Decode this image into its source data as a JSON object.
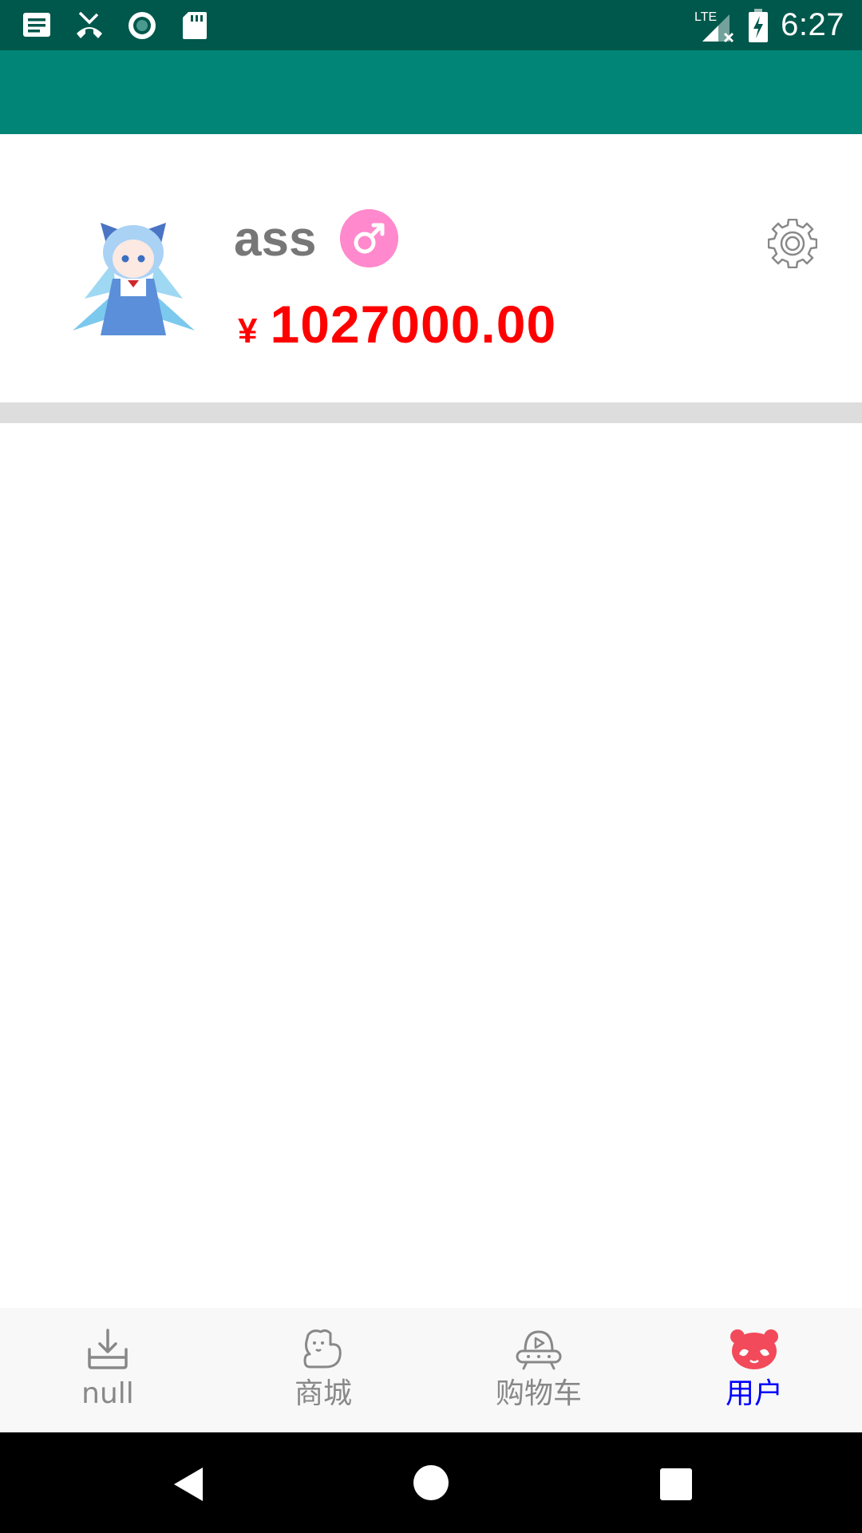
{
  "status_bar": {
    "time": "6:27",
    "network": "LTE",
    "icons_left": [
      "message-icon",
      "missed-call-icon",
      "sync-icon",
      "sd-card-icon"
    ],
    "icons_right": [
      "signal-icon",
      "battery-charging-icon"
    ],
    "background": "#00574b"
  },
  "app_bar": {
    "background": "#008577"
  },
  "user": {
    "name": "ass",
    "gender_icon": "male-symbol-icon",
    "currency_symbol": "¥",
    "balance": "1027000.00",
    "settings_icon": "gear-icon"
  },
  "bottom_nav": {
    "items": [
      {
        "label": "null",
        "icon": "download-tray-icon",
        "active": false
      },
      {
        "label": "商城",
        "icon": "pet-icon",
        "active": false
      },
      {
        "label": "购物车",
        "icon": "ufo-icon",
        "active": false
      },
      {
        "label": "用户",
        "icon": "panda-face-icon",
        "active": true
      }
    ],
    "active_color": "#0000ff",
    "inactive_color": "#888888"
  },
  "system_nav": {
    "buttons": [
      "back-icon",
      "home-icon",
      "recents-icon"
    ]
  },
  "colors": {
    "balance": "#ff0000",
    "gender_badge": "#ff89cc",
    "divider": "#dddddd"
  }
}
